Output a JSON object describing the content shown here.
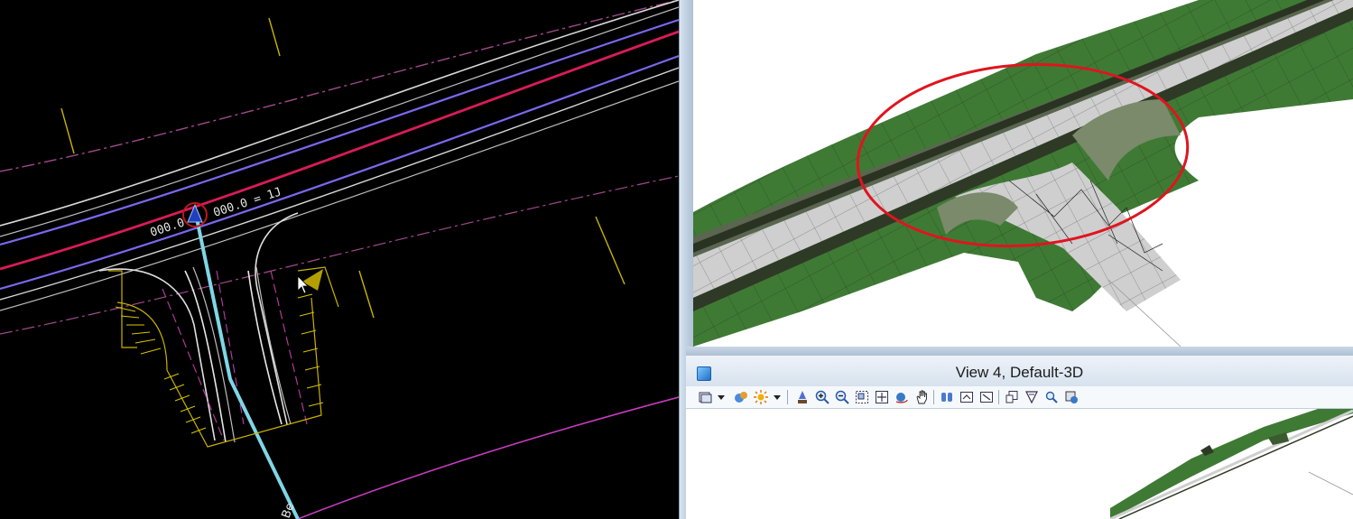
{
  "plan_view": {
    "station_label_1": "000.0",
    "station_label_2": "000.0 = 1J",
    "bottom_label": "Be"
  },
  "view4": {
    "title": "View 4, Default-3D"
  },
  "toolbar_icons": [
    "view-attributes-icon",
    "display-style-icon",
    "lighting-icon",
    "update-view-icon",
    "zoom-in-icon",
    "zoom-out-icon",
    "window-area-icon",
    "fit-view-icon",
    "rotate-view-icon",
    "pan-view-icon",
    "view-previous-icon",
    "view-next-icon",
    "copy-view-icon",
    "clip-volume-icon",
    "clip-mask-icon",
    "camera-icon",
    "render-icon"
  ],
  "colors": {
    "plan_background": "#000000",
    "highlight_ellipse": "#e0141e",
    "terrain_green": "#3f7a35",
    "pavement_gray": "#cfcfcf"
  }
}
